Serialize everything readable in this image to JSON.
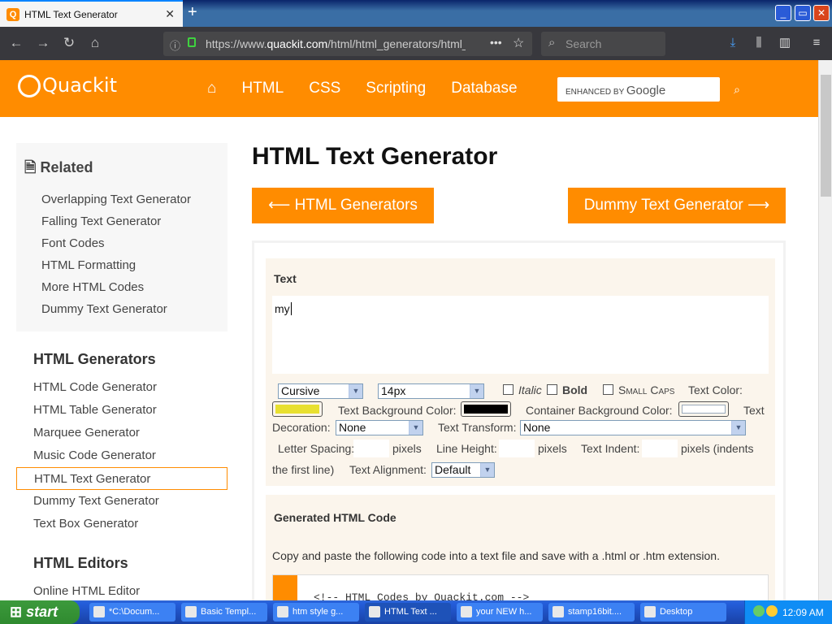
{
  "browser": {
    "tab_title": "HTML Text Generator",
    "tab_close": "✕",
    "new_tab": "+",
    "url_prefix": "https://www.",
    "url_domain": "quackit.com",
    "url_path": "/html/html_generators/html_t",
    "search_placeholder": "Search",
    "win_min": "_",
    "win_max": "▭",
    "win_close": "✕"
  },
  "site": {
    "logo": "Quackit",
    "nav": [
      "HTML",
      "CSS",
      "Scripting",
      "Database"
    ],
    "search_enhanced": "ENHANCED BY",
    "search_google": "Google"
  },
  "sidebar": {
    "related_title": "Related",
    "related_items": [
      "Overlapping Text Generator",
      "Falling Text Generator",
      "Font Codes",
      "HTML Formatting",
      "More HTML Codes",
      "Dummy Text Generator"
    ],
    "generators_title": "HTML Generators",
    "generators": [
      "HTML Code Generator",
      "HTML Table Generator",
      "Marquee Generator",
      "Music Code Generator",
      "HTML Text Generator",
      "Dummy Text Generator",
      "Text Box Generator"
    ],
    "editors_title": "HTML Editors",
    "editors": [
      "Online HTML Editor"
    ]
  },
  "main": {
    "title": "HTML Text Generator",
    "prev_button": "⟵ HTML Generators",
    "next_button": "Dummy Text Generator ⟶",
    "text_label": "Text",
    "text_value": "my",
    "font_family": "Cursive",
    "font_size": "14px",
    "italic": "Italic",
    "bold": "Bold",
    "small_caps": "Small Caps",
    "text_color_label": "Text Color:",
    "text_bg_label": "Text Background Color:",
    "container_bg_label": "Container Background Color:",
    "decoration_label_a": "Text",
    "decoration_label_b": "Decoration:",
    "decoration_value": "None",
    "transform_label": "Text Transform:",
    "transform_value": "None",
    "letter_spacing_label": "Letter Spacing:",
    "pixels1": "pixels",
    "line_height_label": "Line Height:",
    "pixels2": "pixels",
    "text_indent_label": "Text Indent:",
    "pixels_indents": "pixels (indents",
    "first_line": "the first line)",
    "alignment_label": "Text Alignment:",
    "alignment_value": "Default",
    "generated_label": "Generated HTML Code",
    "generated_desc": "Copy and paste the following code into a text file and save with a .html or .htm extension.",
    "code_preview": "<!-- HTML Codes by Quackit.com -->"
  },
  "colors": {
    "accent": "#ff8c00",
    "text_color": "#e8e030",
    "text_bg": "#000000",
    "container_bg": "#ffffff"
  },
  "taskbar": {
    "start": "start",
    "tasks": [
      "*C:\\Docum...",
      "Basic Templ...",
      "htm style g...",
      "HTML Text ...",
      "your NEW h...",
      "stamp16bit....",
      "Desktop"
    ],
    "clock": "12:09 AM"
  }
}
